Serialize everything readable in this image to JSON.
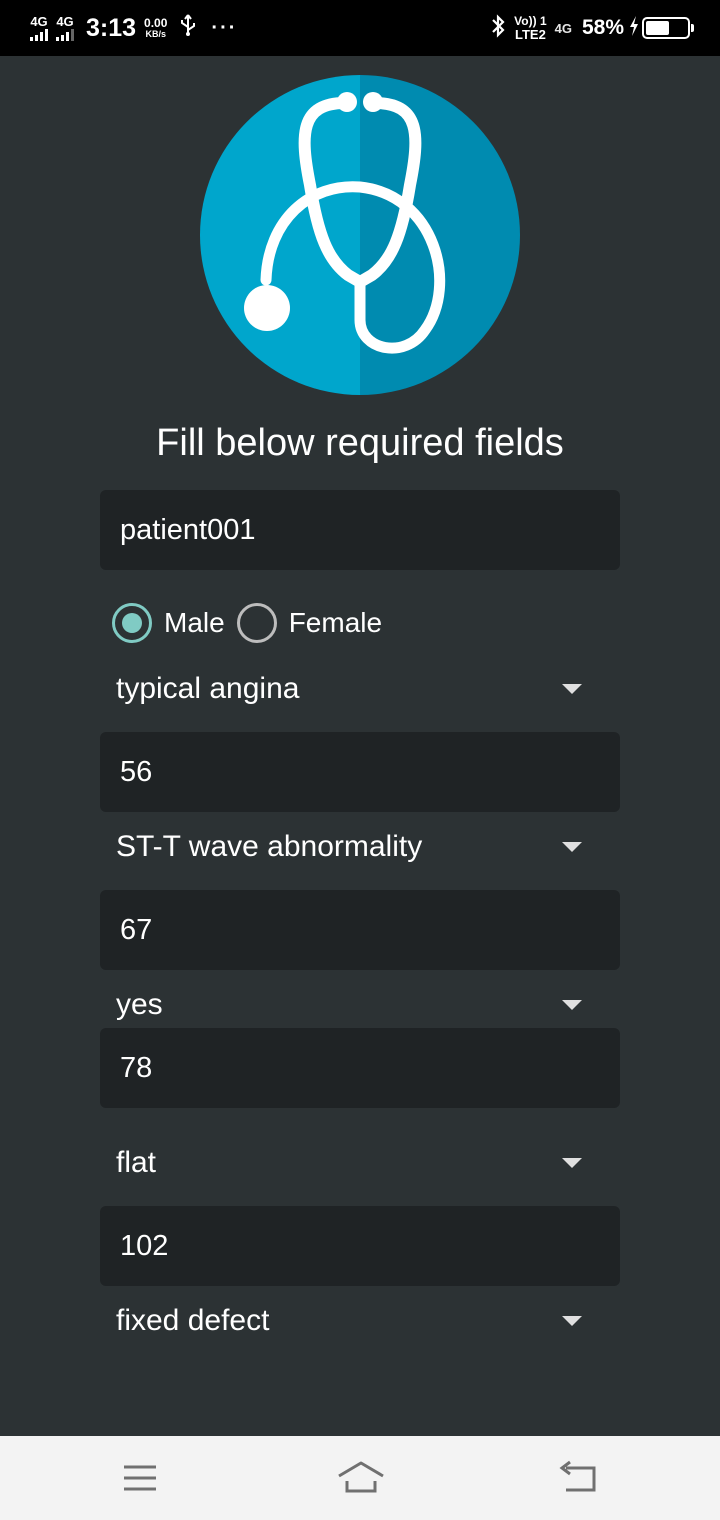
{
  "status_bar": {
    "sim1_network": "4G",
    "sim2_network": "4G",
    "time": "3:13",
    "speed_value": "0.00",
    "speed_unit": "KB/s",
    "more_indicator": "···",
    "volte_label": "Vo)) 1",
    "lte_label": "LTE2",
    "sim2_data_label": "4G",
    "battery_percent": "58%",
    "battery_level": 0.58
  },
  "app": {
    "logo_icon": "stethoscope-icon",
    "heading": "Fill below required fields",
    "patient_id": {
      "value": "patient001"
    },
    "sex": {
      "options": [
        "Male",
        "Female"
      ],
      "selected": "Male"
    },
    "chest_pain_type": "typical angina",
    "field_2": {
      "value": "56"
    },
    "rest_ecg": "ST-T wave abnormality",
    "field_3": {
      "value": "67"
    },
    "exercise_angina": "yes",
    "field_4": {
      "value": "78"
    },
    "slope": "flat",
    "field_5": {
      "value": "102"
    },
    "thal": "fixed defect"
  },
  "navigation_bar": {
    "menu_icon": "menu-icon",
    "home_icon": "home-icon",
    "back_icon": "back-icon"
  },
  "colors": {
    "background": "#2c3234",
    "field_background": "#1f2325",
    "logo_circle": "#00a6cc",
    "logo_shadow": "#008bb0",
    "radio_accent": "#80cbc4"
  }
}
